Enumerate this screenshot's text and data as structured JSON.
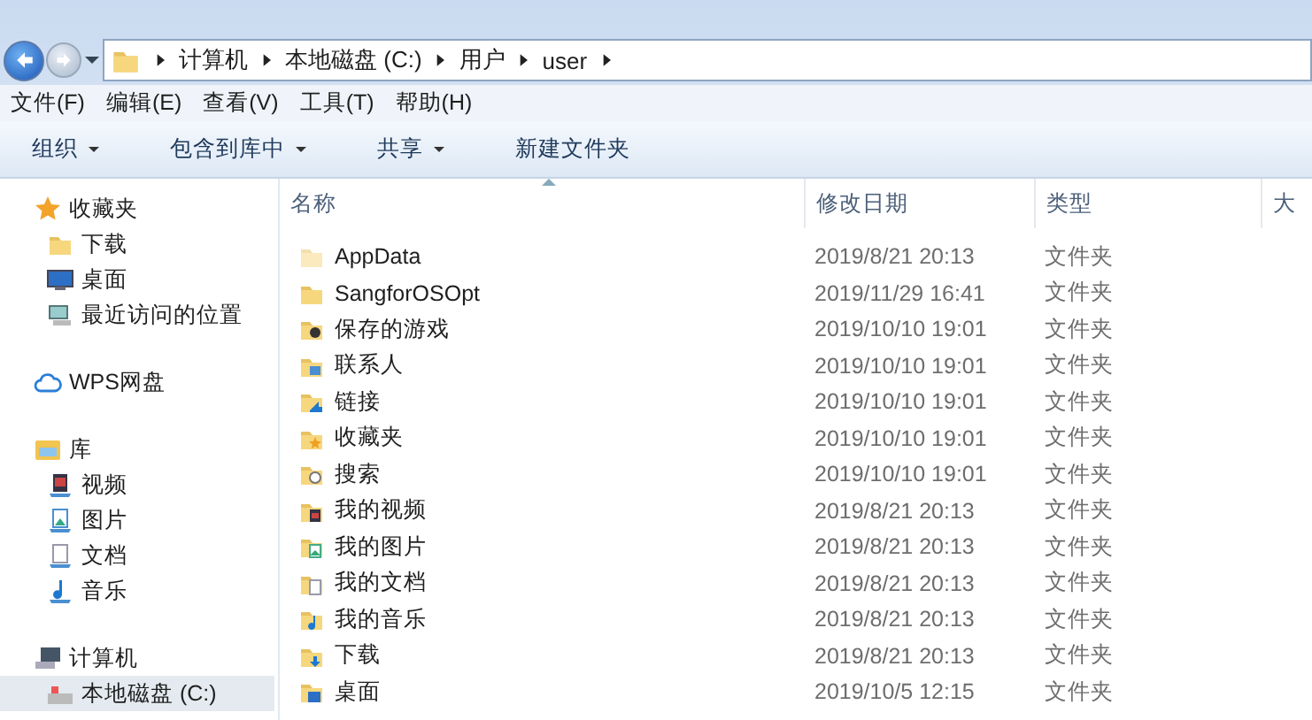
{
  "address_bar": {
    "breadcrumbs": [
      "计算机",
      "本地磁盘 (C:)",
      "用户",
      "user"
    ]
  },
  "menu_bar": [
    "文件(F)",
    "编辑(E)",
    "查看(V)",
    "工具(T)",
    "帮助(H)"
  ],
  "toolbar": [
    {
      "label": "组织",
      "dropdown": true
    },
    {
      "label": "包含到库中",
      "dropdown": true
    },
    {
      "label": "共享",
      "dropdown": true
    },
    {
      "label": "新建文件夹",
      "dropdown": false
    }
  ],
  "sidebar": {
    "groups": [
      {
        "label": "收藏夹",
        "kind": "star",
        "selected": false,
        "children": [
          {
            "label": "下载",
            "kind": "folder",
            "selected": false
          },
          {
            "label": "桌面",
            "kind": "desktop",
            "selected": false
          },
          {
            "label": "最近访问的位置",
            "kind": "recent",
            "selected": false
          }
        ]
      },
      {
        "label": "WPS网盘",
        "kind": "cloud",
        "selected": false
      },
      {
        "label": "库",
        "kind": "library",
        "selected": false,
        "children": [
          {
            "label": "视频",
            "kind": "video",
            "selected": false
          },
          {
            "label": "图片",
            "kind": "picture",
            "selected": false
          },
          {
            "label": "文档",
            "kind": "document",
            "selected": false
          },
          {
            "label": "音乐",
            "kind": "music",
            "selected": false
          }
        ]
      },
      {
        "label": "计算机",
        "kind": "computer",
        "selected": false,
        "children": [
          {
            "label": "本地磁盘 (C:)",
            "kind": "drive",
            "selected": true
          }
        ]
      }
    ]
  },
  "file_list": {
    "columns": [
      {
        "label": "名称",
        "sorted": true
      },
      {
        "label": "修改日期",
        "sorted": false
      },
      {
        "label": "类型",
        "sorted": false
      },
      {
        "label": "大",
        "sorted": false
      }
    ],
    "rows": [
      {
        "name": "AppData",
        "modified": "2019/8/21 20:13",
        "type": "文件夹",
        "kind": "hidden"
      },
      {
        "name": "SangforOSOpt",
        "modified": "2019/11/29 16:41",
        "type": "文件夹",
        "kind": "folder"
      },
      {
        "name": "保存的游戏",
        "modified": "2019/10/10 19:01",
        "type": "文件夹",
        "kind": "games"
      },
      {
        "name": "联系人",
        "modified": "2019/10/10 19:01",
        "type": "文件夹",
        "kind": "contacts"
      },
      {
        "name": "链接",
        "modified": "2019/10/10 19:01",
        "type": "文件夹",
        "kind": "links"
      },
      {
        "name": "收藏夹",
        "modified": "2019/10/10 19:01",
        "type": "文件夹",
        "kind": "favorites"
      },
      {
        "name": "搜索",
        "modified": "2019/10/10 19:01",
        "type": "文件夹",
        "kind": "search"
      },
      {
        "name": "我的视频",
        "modified": "2019/8/21 20:13",
        "type": "文件夹",
        "kind": "video"
      },
      {
        "name": "我的图片",
        "modified": "2019/8/21 20:13",
        "type": "文件夹",
        "kind": "picture"
      },
      {
        "name": "我的文档",
        "modified": "2019/8/21 20:13",
        "type": "文件夹",
        "kind": "document"
      },
      {
        "name": "我的音乐",
        "modified": "2019/8/21 20:13",
        "type": "文件夹",
        "kind": "music"
      },
      {
        "name": "下载",
        "modified": "2019/8/21 20:13",
        "type": "文件夹",
        "kind": "download"
      },
      {
        "name": "桌面",
        "modified": "2019/10/5 12:15",
        "type": "文件夹",
        "kind": "desktop"
      }
    ]
  }
}
